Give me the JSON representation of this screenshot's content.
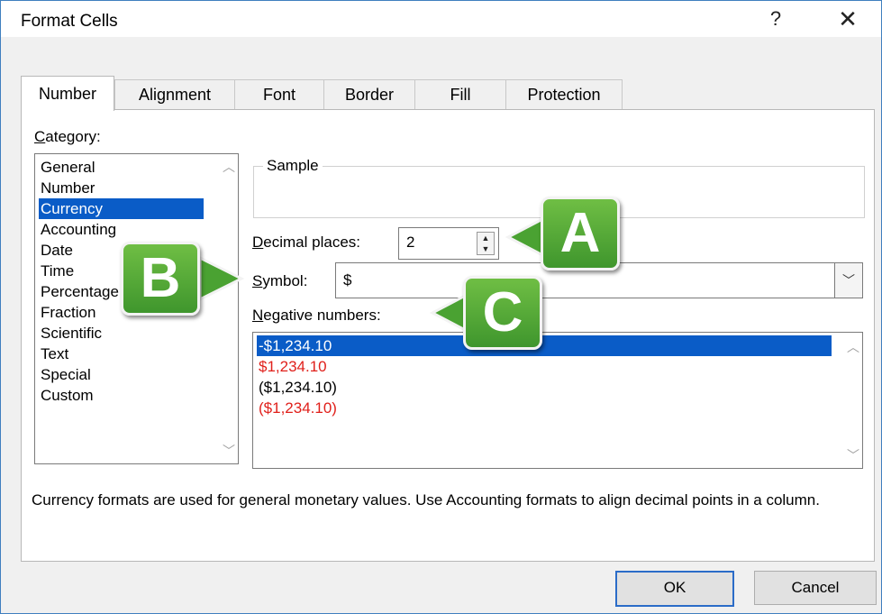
{
  "window": {
    "title": "Format Cells",
    "help_label": "?",
    "close_label": "✕"
  },
  "tabs": [
    {
      "label": "Number",
      "active": true
    },
    {
      "label": "Alignment"
    },
    {
      "label": "Font"
    },
    {
      "label": "Border"
    },
    {
      "label": "Fill"
    },
    {
      "label": "Protection"
    }
  ],
  "category": {
    "label_first": "C",
    "label_rest": "ategory:",
    "items": [
      "General",
      "Number",
      "Currency",
      "Accounting",
      "Date",
      "Time",
      "Percentage",
      "Fraction",
      "Scientific",
      "Text",
      "Special",
      "Custom"
    ],
    "selected": "Currency"
  },
  "sample": {
    "label": "Sample",
    "value": ""
  },
  "decimal_places": {
    "label_first": "D",
    "label_rest": "ecimal places:",
    "value": "2"
  },
  "symbol": {
    "label_first": "S",
    "label_rest": "ymbol:",
    "value": "$"
  },
  "negative_numbers": {
    "label_first": "N",
    "label_rest": "egative numbers:",
    "items": [
      {
        "text": "-$1,234.10",
        "color": "#000000",
        "selected": true
      },
      {
        "text": "$1,234.10",
        "color": "#e0201b"
      },
      {
        "text": "($1,234.10)",
        "color": "#000000"
      },
      {
        "text": "($1,234.10)",
        "color": "#e0201b"
      }
    ]
  },
  "description": "Currency formats are used for general monetary values.  Use Accounting formats to align decimal points in a column.",
  "buttons": {
    "ok": "OK",
    "cancel": "Cancel"
  },
  "callouts": {
    "a": "A",
    "b": "B",
    "c": "C"
  },
  "colors": {
    "selection": "#0a5cc7",
    "callout_green": "#4aa232",
    "negative_red": "#e0201b",
    "window_border": "#3f7fbf"
  }
}
